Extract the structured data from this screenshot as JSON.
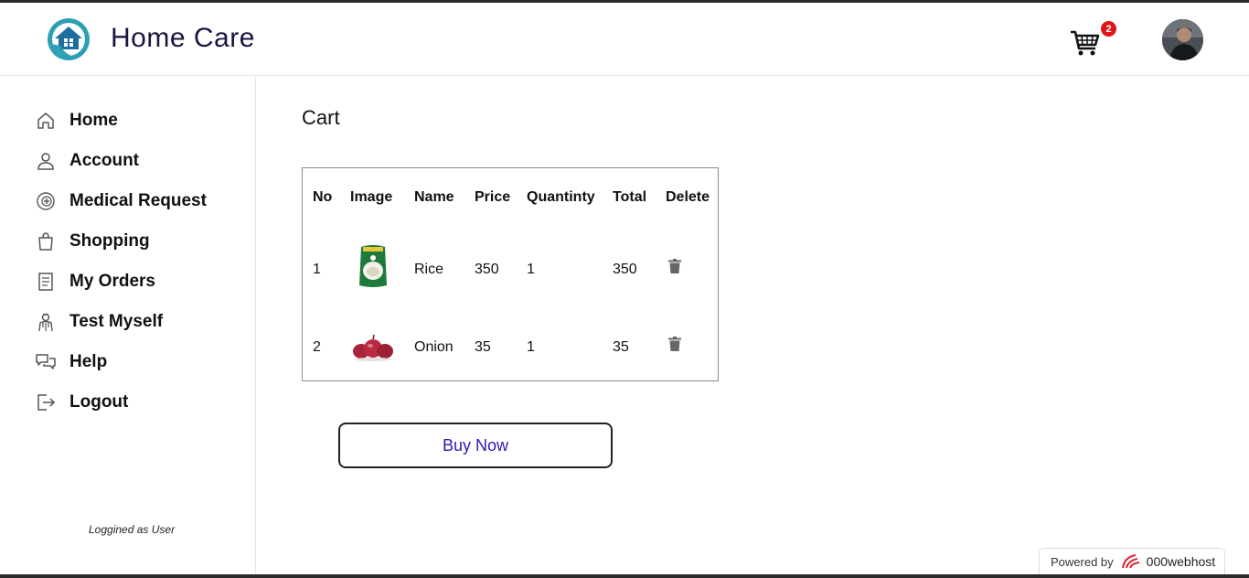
{
  "header": {
    "app_title": "Home Care",
    "logo_icon": "home-heart-icon",
    "cart_icon": "shopping-cart-icon",
    "cart_count": "2",
    "badge_color": "#e0151a",
    "avatar": "user-avatar"
  },
  "sidebar": {
    "items": [
      {
        "label": "Home",
        "icon": "home-icon"
      },
      {
        "label": "Account",
        "icon": "user-icon"
      },
      {
        "label": "Medical Request",
        "icon": "medical-icon"
      },
      {
        "label": "Shopping",
        "icon": "shopping-bag-icon"
      },
      {
        "label": "My Orders",
        "icon": "orders-icon"
      },
      {
        "label": "Test Myself",
        "icon": "doctor-icon"
      },
      {
        "label": "Help",
        "icon": "chat-icon"
      },
      {
        "label": "Logout",
        "icon": "logout-icon"
      }
    ],
    "logged_as": "Loggined as User"
  },
  "main": {
    "title": "Cart",
    "table": {
      "columns": [
        "No",
        "Image",
        "Name",
        "Price",
        "Quantinty",
        "Total",
        "Delete"
      ],
      "rows": [
        {
          "no": "1",
          "name": "Rice",
          "price": "350",
          "quantity": "1",
          "total": "350"
        },
        {
          "no": "2",
          "name": "Onion",
          "price": "35",
          "quantity": "1",
          "total": "35"
        }
      ]
    },
    "buy_label": "Buy Now",
    "buy_text_color": "#2d1ab5"
  },
  "footer": {
    "powered_by": "Powered by",
    "host": "000webhost"
  }
}
